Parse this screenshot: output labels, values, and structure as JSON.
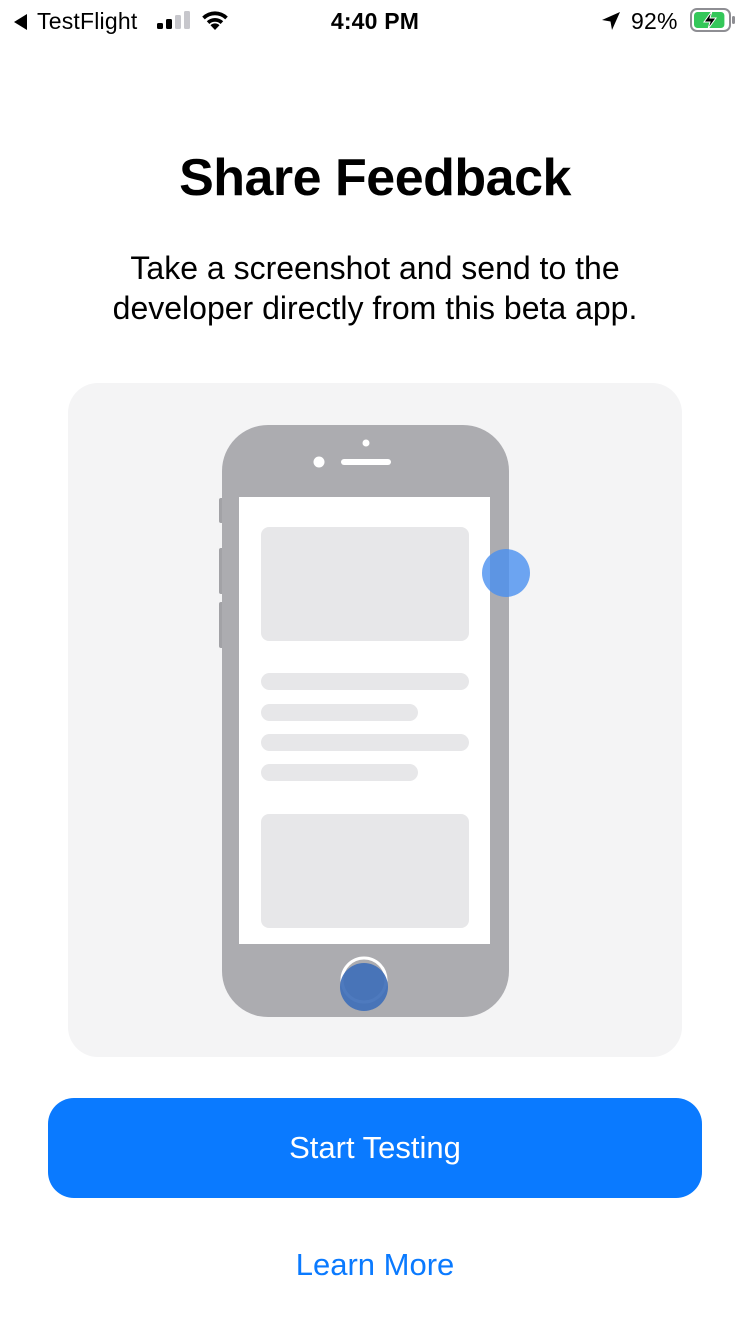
{
  "status_bar": {
    "back_app_label": "TestFlight",
    "time": "4:40 PM",
    "battery_percent": "92%",
    "battery_level": 0.92,
    "signal_bars_filled": 2,
    "signal_bars_total": 4,
    "icons": [
      "back-arrow-icon",
      "cellular-signal-icon",
      "wifi-icon",
      "location-arrow-icon",
      "battery-charging-icon"
    ]
  },
  "onboarding": {
    "title": "Share Feedback",
    "subtitle": "Take a screenshot and send to the developer directly from this beta app."
  },
  "illustration": {
    "icons": [
      "phone-illustration-icon",
      "side-button-press-indicator",
      "home-button-press-indicator"
    ]
  },
  "actions": {
    "primary_label": "Start Testing",
    "secondary_label": "Learn More"
  },
  "colors": {
    "accent": "#0A7AFF",
    "card_background": "#F4F4F5",
    "phone_body": "#ACACB0",
    "placeholder": "#E7E7E9",
    "battery_green": "#34C759",
    "touch_indicator": "#4A90F0"
  }
}
